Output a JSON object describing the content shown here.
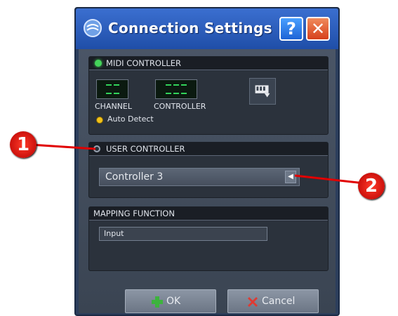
{
  "window": {
    "title": "Connection Settings",
    "help_label": "?",
    "close_label": "✕"
  },
  "midi_controller": {
    "header": "MIDI CONTROLLER",
    "channel_label": "CHANNEL",
    "controller_label": "CONTROLLER",
    "auto_detect_label": "Auto Detect",
    "status_color": "#44d45a"
  },
  "user_controller": {
    "header": "USER CONTROLLER",
    "selected": "Controller 3"
  },
  "mapping_function": {
    "header": "MAPPING FUNCTION",
    "input_value": "Input"
  },
  "buttons": {
    "ok": "OK",
    "cancel": "Cancel"
  },
  "callouts": {
    "one": "1",
    "two": "2"
  },
  "colors": {
    "callout": "#e10000",
    "ok_icon": "#3db33d",
    "cancel_icon": "#e03a32"
  }
}
